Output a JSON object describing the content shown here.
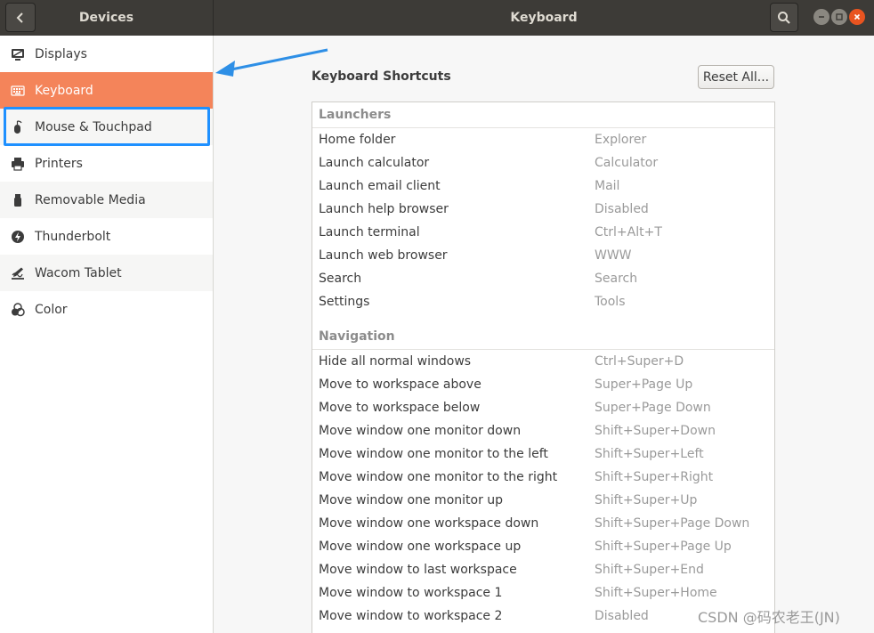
{
  "header": {
    "left_title": "Devices",
    "title": "Keyboard"
  },
  "sidebar": {
    "items": [
      {
        "label": "Displays",
        "icon": "display-icon"
      },
      {
        "label": "Keyboard",
        "icon": "keyboard-icon",
        "selected": true
      },
      {
        "label": "Mouse & Touchpad",
        "icon": "mouse-icon"
      },
      {
        "label": "Printers",
        "icon": "printer-icon"
      },
      {
        "label": "Removable Media",
        "icon": "usb-drive-icon"
      },
      {
        "label": "Thunderbolt",
        "icon": "thunderbolt-icon"
      },
      {
        "label": "Wacom Tablet",
        "icon": "tablet-icon"
      },
      {
        "label": "Color",
        "icon": "color-icon"
      }
    ]
  },
  "main": {
    "title": "Keyboard Shortcuts",
    "reset_label": "Reset All...",
    "sections": [
      {
        "name": "Launchers",
        "rows": [
          {
            "name": "Home folder",
            "key": "Explorer"
          },
          {
            "name": "Launch calculator",
            "key": "Calculator"
          },
          {
            "name": "Launch email client",
            "key": "Mail"
          },
          {
            "name": "Launch help browser",
            "key": "Disabled"
          },
          {
            "name": "Launch terminal",
            "key": "Ctrl+Alt+T"
          },
          {
            "name": "Launch web browser",
            "key": "WWW"
          },
          {
            "name": "Search",
            "key": "Search"
          },
          {
            "name": "Settings",
            "key": "Tools"
          }
        ]
      },
      {
        "name": "Navigation",
        "rows": [
          {
            "name": "Hide all normal windows",
            "key": "Ctrl+Super+D"
          },
          {
            "name": "Move to workspace above",
            "key": "Super+Page Up"
          },
          {
            "name": "Move to workspace below",
            "key": "Super+Page Down"
          },
          {
            "name": "Move window one monitor down",
            "key": "Shift+Super+Down"
          },
          {
            "name": "Move window one monitor to the left",
            "key": "Shift+Super+Left"
          },
          {
            "name": "Move window one monitor to the right",
            "key": "Shift+Super+Right"
          },
          {
            "name": "Move window one monitor up",
            "key": "Shift+Super+Up"
          },
          {
            "name": "Move window one workspace down",
            "key": "Shift+Super+Page Down"
          },
          {
            "name": "Move window one workspace up",
            "key": "Shift+Super+Page Up"
          },
          {
            "name": "Move window to last workspace",
            "key": "Shift+Super+End"
          },
          {
            "name": "Move window to workspace 1",
            "key": "Shift+Super+Home"
          },
          {
            "name": "Move window to workspace 2",
            "key": "Disabled"
          }
        ]
      }
    ]
  },
  "watermark": "CSDN @码农老王(JN)",
  "colors": {
    "accent": "#f4845a",
    "highlight_outline": "#1e90ff",
    "headerbar": "#3d3b37",
    "close_button": "#e95420"
  }
}
